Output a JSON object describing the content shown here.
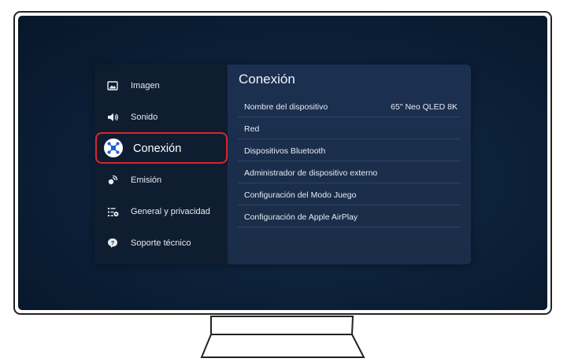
{
  "sidebar": {
    "items": [
      {
        "label": "Imagen",
        "icon": "image-icon"
      },
      {
        "label": "Sonido",
        "icon": "speaker-icon"
      },
      {
        "label": "Conexión",
        "icon": "network-icon",
        "active": true
      },
      {
        "label": "Emisión",
        "icon": "broadcast-icon"
      },
      {
        "label": "General y privacidad",
        "icon": "general-settings-icon"
      },
      {
        "label": "Soporte técnico",
        "icon": "support-icon"
      }
    ]
  },
  "main": {
    "title": "Conexión",
    "rows": [
      {
        "label": "Nombre del dispositivo",
        "value": "65\" Neo QLED 8K"
      },
      {
        "label": "Red",
        "value": ""
      },
      {
        "label": "Dispositivos Bluetooth",
        "value": ""
      },
      {
        "label": "Administrador de dispositivo externo",
        "value": ""
      },
      {
        "label": "Configuración del Modo Juego",
        "value": ""
      },
      {
        "label": "Configuración de Apple AirPlay",
        "value": ""
      }
    ]
  },
  "colors": {
    "highlight": "#d9242e",
    "active_icon": "#1f5fd6"
  }
}
